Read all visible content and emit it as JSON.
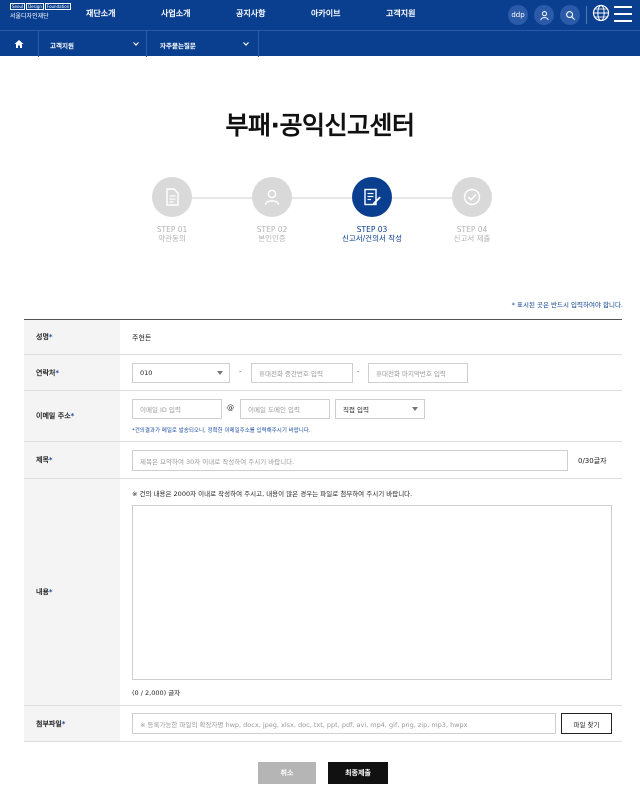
{
  "header": {
    "logo_top": [
      "Seoul",
      "Design",
      "Foundation"
    ],
    "logo_text": "서울디자인재단",
    "menu": [
      "재단소개",
      "사업소개",
      "공지사항",
      "아카이브",
      "고객지원"
    ],
    "ddp_label": "ddp",
    "icons": [
      "user-icon",
      "search-icon",
      "globe-icon",
      "hamburger-icon"
    ]
  },
  "breadcrumb": {
    "level1": "고객지원",
    "level2": "자주묻는질문"
  },
  "page_title": "부패·공익신고센터",
  "steps": [
    {
      "no": "STEP 01",
      "name": "약관동의",
      "icon": "document-icon",
      "active": false
    },
    {
      "no": "STEP 02",
      "name": "본인인증",
      "icon": "person-icon",
      "active": false
    },
    {
      "no": "STEP 03",
      "name": "신고서/건의서 작성",
      "icon": "form-edit-icon",
      "active": true
    },
    {
      "no": "STEP 04",
      "name": "신고서 제출",
      "icon": "check-icon",
      "active": false
    }
  ],
  "required_notice": "* 표시된 곳은 반드시 입력하여야 합니다.",
  "form": {
    "name": {
      "label": "성명",
      "value": "주현돈"
    },
    "contact": {
      "label": "연락처",
      "prefix": "010",
      "middle_placeholder": "휴대전화 중간번호 입력",
      "last_placeholder": "휴대전화 마지막번호 입력"
    },
    "email": {
      "label": "이메일 주소",
      "id_placeholder": "이메일 ID 입력",
      "at": "@",
      "domain_placeholder": "이메일 도메인 입력",
      "domain_select": "직접 입력",
      "note": "*건의결과가 메일로 발송되오니, 정확한 이메일주소를 입력해주시기 바랍니다."
    },
    "subject": {
      "label": "제목",
      "placeholder": "제목은 요약하여 30자 이내로 작성하여 주시기 바랍니다.",
      "counter": "0/30글자"
    },
    "content": {
      "label": "내용",
      "guide": "※ 건의 내용은 2000자 이내로 작성하여 주시고, 내용이 많은 경우는 파일로 첨부하여 주시기 바랍니다.",
      "counter": "(0 / 2,000) 글자"
    },
    "attachment": {
      "label": "첨부파일",
      "placeholder": "※ 등록가능한 파일의 확장자명 hwp, docx, jpeg, xlsx, doc, txt, ppt, pdf, avi, mp4, gif, png, zip, mp3, hwpx",
      "button": "파일 찾기"
    },
    "required_mark": "*"
  },
  "buttons": {
    "cancel": "취소",
    "submit": "최종제출"
  },
  "colors": {
    "brand_blue": "#0a3f8f",
    "step_inactive": "#d9d9d9"
  }
}
